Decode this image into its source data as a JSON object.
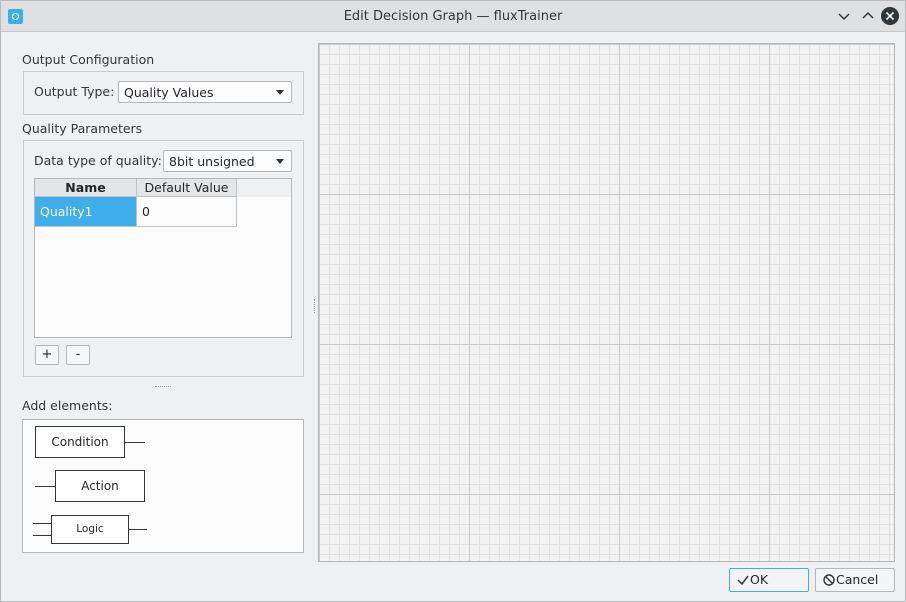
{
  "window": {
    "title": "Edit Decision Graph — fluxTrainer"
  },
  "output_config": {
    "heading": "Output Configuration",
    "type_label": "Output Type:",
    "type_value": "Quality Values"
  },
  "quality_params": {
    "heading": "Quality Parameters",
    "datatype_label": "Data type of quality:",
    "datatype_value": "8bit unsigned",
    "columns": [
      "Name",
      "Default Value"
    ],
    "rows": [
      {
        "name": "Quality1",
        "default": "0"
      }
    ],
    "add_label": "+",
    "remove_label": "-"
  },
  "add_elements": {
    "heading": "Add elements:",
    "items": [
      "Condition",
      "Action",
      "Logic"
    ]
  },
  "buttons": {
    "ok": "OK",
    "cancel": "Cancel"
  },
  "colors": {
    "accent": "#3daee9",
    "window_bg": "#eff0f1"
  }
}
